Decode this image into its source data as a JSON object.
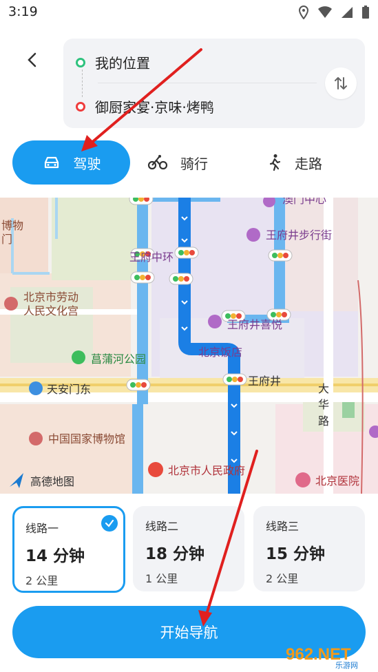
{
  "status_bar": {
    "time": "3:19"
  },
  "route": {
    "origin": "我的位置",
    "destination": "御厨家宴·京味·烤鸭"
  },
  "modes": [
    {
      "label": "驾驶",
      "icon": "car-icon",
      "active": true
    },
    {
      "label": "骑行",
      "icon": "bicycle-icon",
      "active": false
    },
    {
      "label": "走路",
      "icon": "walk-icon",
      "active": false
    }
  ],
  "map": {
    "logo": "高德地图",
    "labels": [
      "博物",
      "门",
      "北京市劳动",
      "人民文化宫",
      "菖蒲河公园",
      "天安门东",
      "中国国家博物馆",
      "北京市人民政府",
      "北京医院",
      "王府井步行街",
      "王府中环",
      "王府井喜悦",
      "北京饭店",
      "王府井",
      "大",
      "华",
      "路",
      "澳门中心"
    ]
  },
  "route_options": [
    {
      "name": "线路一",
      "time": "14 分钟",
      "distance": "2 公里",
      "selected": true
    },
    {
      "name": "线路二",
      "time": "18 分钟",
      "distance": "1 公里",
      "selected": false
    },
    {
      "name": "线路三",
      "time": "15 分钟",
      "distance": "2 公里",
      "selected": false
    }
  ],
  "start_button": {
    "label": "开始导航"
  },
  "watermark": {
    "text": "962.NET",
    "sub": "乐游网"
  },
  "colors": {
    "accent": "#1a9cf0",
    "origin": "#2ec27e",
    "destination": "#ef3c3c",
    "annotation": "#e0201f"
  }
}
